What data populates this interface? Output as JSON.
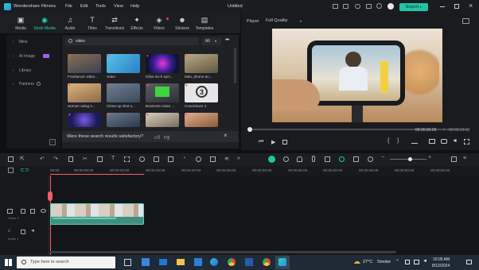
{
  "app": {
    "name": "Wondershare Filmora",
    "doc_title": "Untitled"
  },
  "menu": [
    "File",
    "Edit",
    "Tools",
    "View",
    "Help"
  ],
  "export_label": "Export",
  "toolbar": [
    {
      "label": "Media",
      "glyph": "▣"
    },
    {
      "label": "Stock Media",
      "glyph": "◉",
      "active": true
    },
    {
      "label": "Audio",
      "glyph": "♫"
    },
    {
      "label": "Titles",
      "glyph": "T"
    },
    {
      "label": "Transitions",
      "glyph": "⇄"
    },
    {
      "label": "Effects",
      "glyph": "✦"
    },
    {
      "label": "Filters",
      "glyph": "◈"
    },
    {
      "label": "Stickers",
      "glyph": "☻"
    },
    {
      "label": "Templates",
      "glyph": "▤"
    }
  ],
  "leftnav": [
    {
      "label": "Mine"
    },
    {
      "label": "AI Image"
    },
    {
      "label": "Library"
    },
    {
      "label": "Partners"
    }
  ],
  "search": {
    "value": "video",
    "filter": "All"
  },
  "media_items": [
    {
      "caption": "Freelancer video...",
      "color": "#6b5a4a"
    },
    {
      "caption": "video",
      "color": "#3aa7d6"
    },
    {
      "caption": "Glow sci-fi sym...",
      "color": "#3a2a7a"
    },
    {
      "caption": "Man, phone an...",
      "color": "#8a7a5a"
    },
    {
      "caption": "woman using s...",
      "color": "#c9a06a"
    },
    {
      "caption": "Close-up shot o...",
      "color": "#5a6a7a"
    },
    {
      "caption": "Business Asian ...",
      "color": "#4aa64a"
    },
    {
      "caption": "Countdown 4",
      "color": "#e8e8e8"
    },
    {
      "caption": "",
      "color": "#2a3a8a"
    },
    {
      "caption": "",
      "color": "#4a5a6a"
    },
    {
      "caption": "",
      "color": "#7a6a5a"
    },
    {
      "caption": "",
      "color": "#b07a5a"
    }
  ],
  "feedback": {
    "text": "Were these search results satisfactory?"
  },
  "player": {
    "label": "Player",
    "quality": "Full Quality",
    "time_current": "00:00:00:00",
    "time_total": "00:00:13:10"
  },
  "ruler": [
    "00:00",
    "00:00:05:00",
    "00:00:10:00",
    "00:00:15:00",
    "00:00:20:00",
    "00:00:25:00",
    "00:00:30:00",
    "00:00:35:00",
    "00:00:40:00",
    "00:00:45:00",
    "00:00:50:00",
    "00:00:55:00"
  ],
  "tracks": {
    "video_label": "Video 1",
    "audio_label": "Audio 1"
  },
  "taskbar": {
    "search_placeholder": "Type here to search",
    "weather_temp": "27°C",
    "weather_text": "Smoke",
    "time": "10:05 AM",
    "date": "8/12/2024"
  },
  "colors": {
    "accent": "#1fc6a6",
    "clip": "#3f8f80",
    "playhead": "#ff5a6e"
  }
}
